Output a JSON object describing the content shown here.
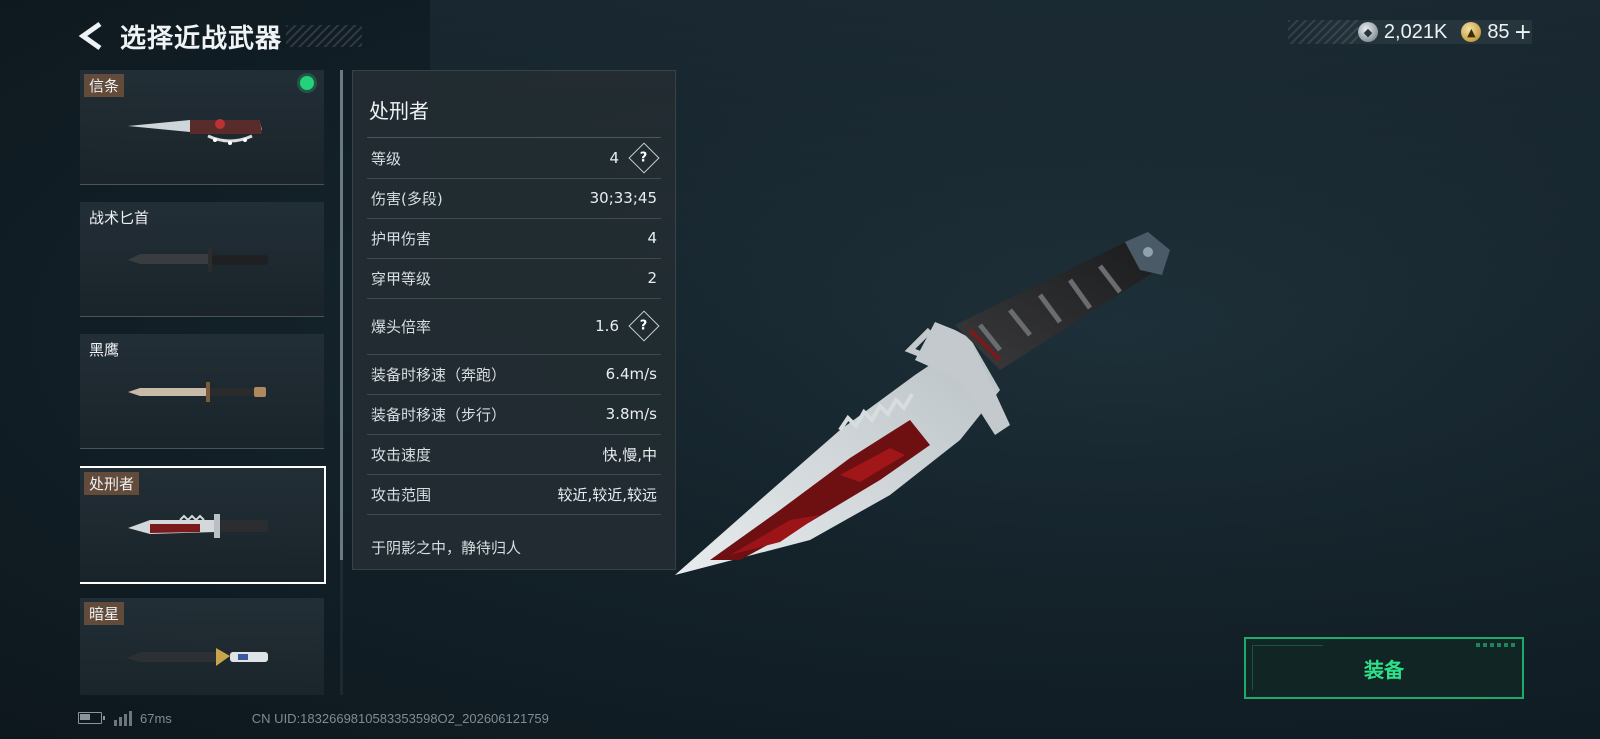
{
  "header": {
    "title": "选择近战武器"
  },
  "currency": [
    {
      "icon": "silver-coin-icon",
      "value": "2,021K"
    },
    {
      "icon": "gold-coin-icon",
      "value": "85"
    }
  ],
  "currency_plus": "+",
  "weapons": [
    {
      "name": "信条",
      "equipped": true,
      "selected": false
    },
    {
      "name": "战术匕首",
      "equipped": false,
      "selected": false
    },
    {
      "name": "黑鹰",
      "equipped": false,
      "selected": false
    },
    {
      "name": "处刑者",
      "equipped": false,
      "selected": true
    },
    {
      "name": "暗星",
      "equipped": false,
      "selected": false
    }
  ],
  "stats": {
    "title": "处刑者",
    "rows": [
      {
        "label": "等级",
        "value": "4",
        "help": true
      },
      {
        "label": "伤害(多段)",
        "value": "30;33;45",
        "help": false
      },
      {
        "label": "护甲伤害",
        "value": "4",
        "help": false
      },
      {
        "label": "穿甲等级",
        "value": "2",
        "help": false
      },
      {
        "label": "爆头倍率",
        "value": "1.6",
        "help": true
      },
      {
        "label": "装备时移速（奔跑）",
        "value": "6.4m/s",
        "help": false
      },
      {
        "label": "装备时移速（步行）",
        "value": "3.8m/s",
        "help": false
      },
      {
        "label": "攻击速度",
        "value": "快,慢,中",
        "help": false
      },
      {
        "label": "攻击范围",
        "value": "较近,较近,较远",
        "help": false
      }
    ],
    "description": "于阴影之中，静待归人",
    "help_glyph": "?"
  },
  "equip_button": {
    "label": "装备"
  },
  "status": {
    "battery_level": 0.5,
    "ping": "67ms",
    "uid": "CN UID:1832669810583353598O2_202606121759"
  },
  "colors": {
    "accent": "#2ee08a",
    "equipped": "#22d37a"
  }
}
